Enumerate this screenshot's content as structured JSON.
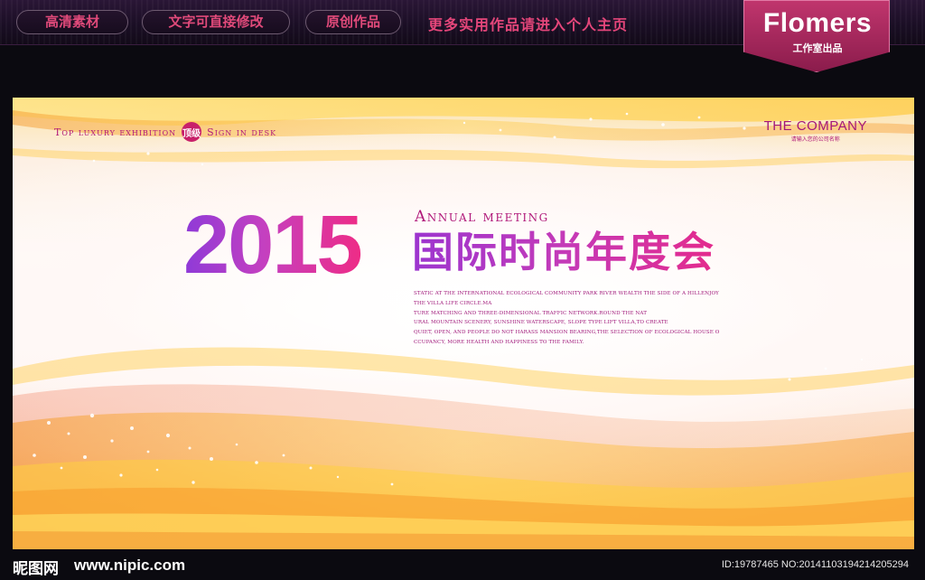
{
  "top_banner": {
    "pills": [
      "高清素材",
      "文字可直接修改",
      "原创作品"
    ],
    "slogan": "更多实用作品请进入个人主页"
  },
  "brand": {
    "name": "Flomers",
    "subtitle": "工作室出品"
  },
  "poster": {
    "top_line_left": "Top luxury exhibition",
    "tag": "顶级",
    "top_line_right": "Sign in desk",
    "company_name": "THE COMPANY",
    "company_sub": "请输入您的公司名称",
    "year": "2015",
    "annual": "Annual meeting",
    "title_cn": "国际时尚年度会",
    "description_lines": [
      "STATIC AT THE INTERNATIONAL ECOLOGICAL COMMUNITY PARK RIVER WEALTH THE SIDE OF A HILLENJOY",
      "THE VILLA LIFE CIRCLE.MA",
      "TURE MATCHING AND THREE-DIMENSIONAL TRAFFIC NETWORK.ROUND THE NAT",
      "URAL MOUNTAIN SCENERY, SUNSHINE WATERSCAPE, SLOPE TYPE LIFT VILLA,TO CREATE",
      "QUIET, OPEN, AND PEOPLE DO NOT HARASS MANSION BEARING,THE SELECTION OF ECOLOGICAL HOUSE O",
      "CCUPANCY, MORE HEALTH AND HAPPINESS TO THE FAMILY."
    ],
    "colors": {
      "accent_magenta": "#b0197a",
      "year_gradient_start": "#8e3ad8",
      "year_gradient_end": "#ee2c86",
      "wave_orange": "#f8a23a",
      "wave_yellow": "#ffd84a"
    }
  },
  "footer": {
    "logo": "昵图网",
    "url": "www.nipic.com",
    "image_id": "ID:19787465 NO:20141103194214205294"
  }
}
